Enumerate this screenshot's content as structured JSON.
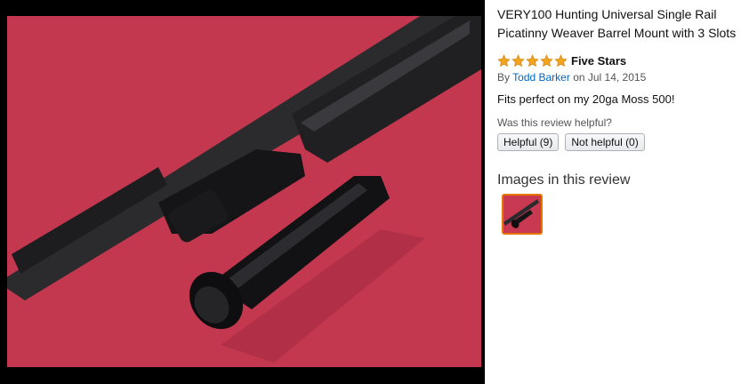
{
  "product": {
    "title_line1": "VERY100 Hunting Universal Single Rail",
    "title_line2": "Picatinny Weaver Barrel Mount with 3 Slots"
  },
  "review": {
    "rating": 5,
    "rating_max": 5,
    "star_color": "#f4a41c",
    "title": "Five Stars",
    "by_prefix": "By",
    "author": "Todd Barker",
    "date_text": "on Jul 14, 2015",
    "body": "Fits perfect on my 20ga Moss 500!",
    "helpful_question": "Was this review helpful?",
    "helpful_button": "Helpful (9)",
    "not_helpful_button": "Not helpful (0)"
  },
  "images_section": {
    "heading": "Images in this review"
  },
  "colors": {
    "link": "#0066c0",
    "accent_border": "#e77600"
  }
}
